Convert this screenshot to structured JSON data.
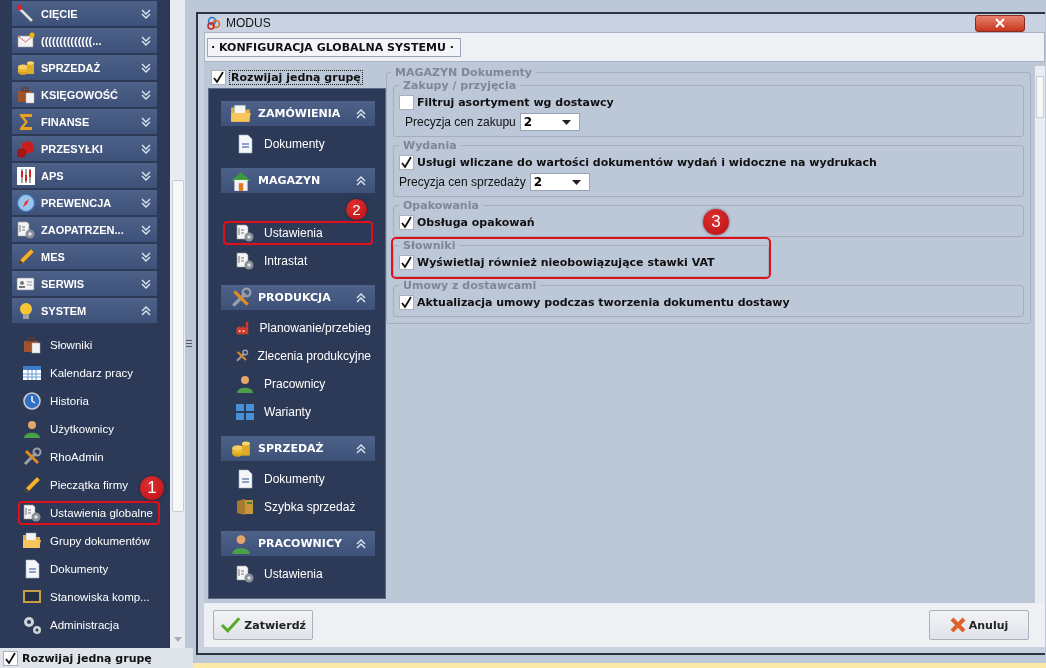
{
  "sidebar": {
    "groups": [
      {
        "label": "CIĘCIE",
        "expanded": false
      },
      {
        "label": "((((((((((((((...",
        "expanded": false
      },
      {
        "label": "SPRZEDAŻ",
        "expanded": false
      },
      {
        "label": "KSIĘGOWOŚĆ",
        "expanded": false
      },
      {
        "label": "FINANSE",
        "expanded": false
      },
      {
        "label": "PRZESYŁKI",
        "expanded": false
      },
      {
        "label": "APS",
        "expanded": false
      },
      {
        "label": "PREWENCJA",
        "expanded": false
      },
      {
        "label": "ZAOPATRZEN...",
        "expanded": false
      },
      {
        "label": "MES",
        "expanded": false
      },
      {
        "label": "SERWIS",
        "expanded": false
      },
      {
        "label": "SYSTEM",
        "expanded": true,
        "items": [
          {
            "label": "Słowniki",
            "highlighted": false
          },
          {
            "label": "Kalendarz pracy",
            "highlighted": false
          },
          {
            "label": "Historia",
            "highlighted": false
          },
          {
            "label": "Użytkownicy",
            "highlighted": false
          },
          {
            "label": "RhoAdmin",
            "highlighted": false
          },
          {
            "label": "Pieczątka firmy",
            "highlighted": false
          },
          {
            "label": "Ustawienia globalne",
            "highlighted": true,
            "callout": "1"
          },
          {
            "label": "Grupy dokumentów",
            "highlighted": false
          },
          {
            "label": "Dokumenty",
            "highlighted": false
          },
          {
            "label": "Stanowiska komp...",
            "highlighted": false
          },
          {
            "label": "Administracja",
            "highlighted": false
          }
        ]
      }
    ],
    "expand_one_group": {
      "label": "Rozwijaj jedną grupę",
      "checked": true
    }
  },
  "window": {
    "title": "MODUS",
    "section_title": "· KONFIGURACJA GLOBALNA SYSTEMU ·",
    "expand_one_group": {
      "label": "Rozwijaj jedną grupę",
      "checked": true
    },
    "nav": [
      {
        "label": "ZAMÓWIENIA",
        "expanded": true,
        "items": [
          {
            "label": "Dokumenty",
            "highlighted": false
          }
        ]
      },
      {
        "label": "MAGAZYN",
        "expanded": true,
        "items": [
          {
            "label": "Ustawienia",
            "highlighted": true,
            "callout": "2"
          },
          {
            "label": "Intrastat",
            "highlighted": false
          }
        ]
      },
      {
        "label": "PRODUKCJA",
        "expanded": true,
        "items": [
          {
            "label": "Planowanie/przebieg",
            "highlighted": false
          },
          {
            "label": "Zlecenia produkcyjne",
            "highlighted": false
          },
          {
            "label": "Pracownicy",
            "highlighted": false
          },
          {
            "label": "Warianty",
            "highlighted": false
          }
        ]
      },
      {
        "label": "SPRZEDAŻ",
        "expanded": true,
        "items": [
          {
            "label": "Dokumenty",
            "highlighted": false
          },
          {
            "label": "Szybka sprzedaż",
            "highlighted": false
          }
        ]
      },
      {
        "label": "PRACOWNICY",
        "expanded": true,
        "items": [
          {
            "label": "Ustawienia",
            "highlighted": false
          }
        ]
      }
    ],
    "settings": {
      "title": "MAGAZYN Dokumenty",
      "groups": [
        {
          "title": "Zakupy / przyjęcia",
          "highlighted": false,
          "rows": [
            {
              "kind": "checkbox",
              "label": "Filtruj asortyment wg dostawcy",
              "checked": false
            },
            {
              "kind": "select",
              "label": "Precyzja cen zakupu",
              "value": "2"
            }
          ]
        },
        {
          "title": "Wydania",
          "highlighted": false,
          "rows": [
            {
              "kind": "checkbox",
              "label": "Usługi wliczane do wartości dokumentów wydań i widoczne na wydrukach",
              "checked": true
            },
            {
              "kind": "select",
              "label": "Precyzja cen sprzedaży",
              "value": "2"
            }
          ]
        },
        {
          "title": "Opakowania",
          "highlighted": false,
          "rows": [
            {
              "kind": "checkbox",
              "label": "Obsługa opakowań",
              "checked": true
            }
          ]
        },
        {
          "title": "Słowniki",
          "highlighted": true,
          "callout": "3",
          "rows": [
            {
              "kind": "checkbox",
              "label": "Wyświetlaj również nieobowiązujące stawki VAT",
              "checked": true
            }
          ]
        },
        {
          "title": "Umowy z dostawcami",
          "highlighted": false,
          "rows": [
            {
              "kind": "checkbox",
              "label": "Aktualizacja umowy podczas tworzenia dokumentu dostawy",
              "checked": true
            }
          ]
        }
      ]
    },
    "buttons": [
      {
        "label": "Zatwierdź",
        "kind": "confirm"
      },
      {
        "label": "Anuluj",
        "kind": "cancel"
      }
    ]
  }
}
